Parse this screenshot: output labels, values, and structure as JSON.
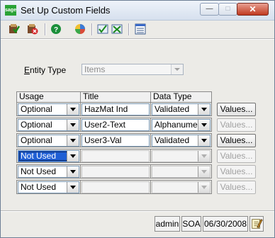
{
  "window": {
    "title": "Set Up Custom Fields",
    "logo_text": "sage"
  },
  "toolbar": {
    "buttons": [
      {
        "icon": "accept-icon"
      },
      {
        "icon": "delete-icon"
      },
      {
        "icon": "help-icon"
      },
      {
        "icon": "color-icon"
      },
      {
        "icon": "check-icon"
      },
      {
        "icon": "transfer-icon"
      },
      {
        "icon": "list-icon"
      }
    ]
  },
  "entity": {
    "label": "Entity Type",
    "value": "Items"
  },
  "grid": {
    "headers": {
      "usage": "Usage",
      "title": "Title",
      "data_type": "Data Type"
    },
    "rows": [
      {
        "usage": "Optional",
        "title": "HazMat Ind",
        "data_type": "Validated",
        "values_label": "Values...",
        "enabled": true
      },
      {
        "usage": "Optional",
        "title": "User2-Text",
        "data_type": "Alphanumeric",
        "values_label": "Values...",
        "enabled": false
      },
      {
        "usage": "Optional",
        "title": "User3-Val",
        "data_type": "Validated",
        "values_label": "Values...",
        "enabled": true
      },
      {
        "usage": "Not Used",
        "title": "",
        "data_type": "",
        "values_label": "Values...",
        "enabled": false,
        "selected": true
      },
      {
        "usage": "Not Used",
        "title": "",
        "data_type": "",
        "values_label": "Values...",
        "enabled": false
      },
      {
        "usage": "Not Used",
        "title": "",
        "data_type": "",
        "values_label": "Values...",
        "enabled": false
      }
    ]
  },
  "status": {
    "user": "admin",
    "company": "SOA",
    "date": "06/30/2008"
  }
}
